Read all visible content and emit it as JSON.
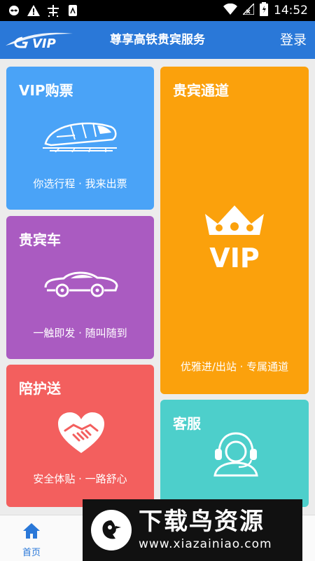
{
  "status_bar": {
    "time": "14:52",
    "icons": [
      "infinity-icon",
      "warning-icon",
      "app-icon",
      "sim-icon",
      "wifi-icon",
      "no-signal-icon",
      "battery-icon"
    ]
  },
  "header": {
    "logo_text": "VIP",
    "title": "尊享高铁贵宾服务",
    "login_label": "登录"
  },
  "cards": {
    "vip_ticket": {
      "title": "VIP购票",
      "subtitle": "你选行程 · 我来出票",
      "icon": "train-icon",
      "color": "#4aa3f7"
    },
    "vip_car": {
      "title": "贵宾车",
      "subtitle": "一触即发 · 随叫随到",
      "icon": "car-icon",
      "color": "#aa5bc1"
    },
    "escort": {
      "title": "陪护送",
      "subtitle": "安全体贴 · 一路舒心",
      "icon": "handshake-heart-icon",
      "color": "#f35f5e"
    },
    "vip_channel": {
      "title": "贵宾通道",
      "subtitle": "优雅进/出站 · 专属通道",
      "icon": "crown-vip-icon",
      "icon_text": "VIP",
      "color": "#fba10c"
    },
    "service": {
      "title": "客服",
      "icon": "headset-icon",
      "color": "#4dcfcb"
    }
  },
  "bottom_nav": {
    "home_label": "首页",
    "accent": "#2a78d8"
  },
  "watermark": {
    "title": "下载鸟资源",
    "url": "www.xiazainiao.com"
  }
}
